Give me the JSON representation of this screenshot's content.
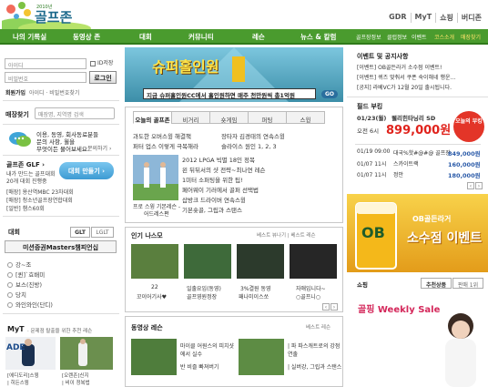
{
  "header": {
    "logo_sub": "2010년",
    "logo_text": "골프존",
    "top_links": [
      "GDR",
      "MyT",
      "쇼핑",
      "버디존"
    ]
  },
  "gnb": {
    "menu": [
      "나의 기록실",
      "동영상 존",
      "대회",
      "커뮤니티",
      "레슨",
      "뉴스 & 칼럼"
    ],
    "sub_links": [
      "골프장정보",
      "클럽정보",
      "이벤트",
      "코스소개",
      "매장찾기"
    ]
  },
  "login": {
    "id_placeholder": "아이디",
    "pw_placeholder": "비밀번호",
    "save_id": "ID저장",
    "login_button": "로그인",
    "join": "회원가입",
    "find": "아이디 · 비밀번호찾기"
  },
  "store_search": {
    "label": "매장찾기",
    "placeholder": "매장명, 지역명 검색"
  },
  "inquiry": {
    "line1": "이용, 동영, 회사동료분들",
    "line2": "문의 사항, 월을",
    "line3": "무엇이든 물어보세요.",
    "link": "문의하기 ›"
  },
  "zone_glf": {
    "title": "골프존 GLF ›",
    "line1": "내가 만드는 골프대회",
    "line2": "20개 대회 진행중",
    "button": "대회 만들기 ›",
    "items": [
      "[매장] 용산역MBC 23차대회",
      "[매장] 청소년골프장연합대회",
      "[일반] 챔스60회"
    ]
  },
  "tournament": {
    "label": "대회",
    "tabs": [
      "GLT",
      "LGLT"
    ],
    "selected": "미션증권Masters챔피언십",
    "ranks": [
      "강~조",
      "[퀸]`효배미",
      "보스(진방)",
      "당치",
      "와인와인(단디)"
    ]
  },
  "myt": {
    "title": "MyT",
    "desc": "· 문제점 탈출을 위한 추천 레슨",
    "captions": [
      "[에디도리]스윙",
      "[오렌존]신지",
      "| 히든스윙",
      "| 비이 정복법"
    ]
  },
  "banner": {
    "title": "슈퍼홀인원",
    "caption": "지금 슈퍼홀인원CC에서 홀인원하면 매주 천만원씩 총1억원",
    "go": "GO"
  },
  "center_tabs": [
    "오늘의 골프존",
    "비거리",
    "숏게임",
    "퍼팅",
    "스윙"
  ],
  "today": {
    "headline_left": "과도한 오버스윙 해결책",
    "headline_right": "장타자 김경태의 연속스윙",
    "line2": "퍼터 업스 이렇게 극복해라",
    "line2_right": "슬라이스 원인 1, 2, 3",
    "thumb_caption1": "프로 스윙 기본레슨 -",
    "thumb_caption2": "어드레스편",
    "list": [
      "2012 LPGA 빅별 18인 정복",
      "왼 뒤뒤서의 샷 전략~최나연 레슨",
      "1미터 소퍼팅을 위한 팁!",
      "페어웨이 기러에서 골퍼 선택법",
      "삽방크 드라이버 연속스윙",
      "기본숏골, 그립과 스탠스"
    ]
  },
  "popular": {
    "title": "인기 나스모",
    "meta": "베스트 뷰나기 | 베스트 레슨",
    "captions": [
      "22",
      "꼬이어기사♥",
      "일출요입(동영)",
      "골프영원정장",
      "3%결원 동영",
      "패나미이스쏘",
      "자애입니다~",
      "○골프니○"
    ]
  },
  "video_lesson": {
    "title": "동영상 레슨",
    "meta": "베스트 레슨",
    "items": [
      "마이클 어원스의 피치샷에서 실수",
      "반 비즐 빠져버기",
      "| 파 파스캐트로의 강점 연출",
      "| 실버강, 그립과 스탠스"
    ]
  },
  "events": {
    "title": "이벤트 및 공지사항",
    "items": [
      "[이벤트] OB골든라거 소수점 이벤트!",
      "[이벤트] 퀴즈 맞춰서 쿠폰 숙이해네 행운...",
      "[공지] 라베VC가 12월 20일 출시됩니다."
    ]
  },
  "deals": {
    "title": "필드 부킹",
    "date1": "01/23(월)",
    "course1": "웰리힌타닝리 SD",
    "time1": "오전 6시",
    "price1": "899,000원",
    "badge": "오늘의 부킹",
    "rows": [
      {
        "date": "01/19 09:00",
        "name": "대국%핫#@#@ 골프장",
        "price": "849,000원"
      },
      {
        "date": "01/07 11시",
        "name": "스카이트랙",
        "price": "160,000원"
      },
      {
        "date": "01/07 11시",
        "name": "정안",
        "price": "180,000원"
      }
    ]
  },
  "ob": {
    "line1": "OB골든라거",
    "line2": "소수점 이벤트"
  },
  "shop": {
    "title": "쇼핑",
    "tabs": [
      "추천상품",
      "판매 1위"
    ],
    "weekly": "골핑 Weekly Sale"
  }
}
